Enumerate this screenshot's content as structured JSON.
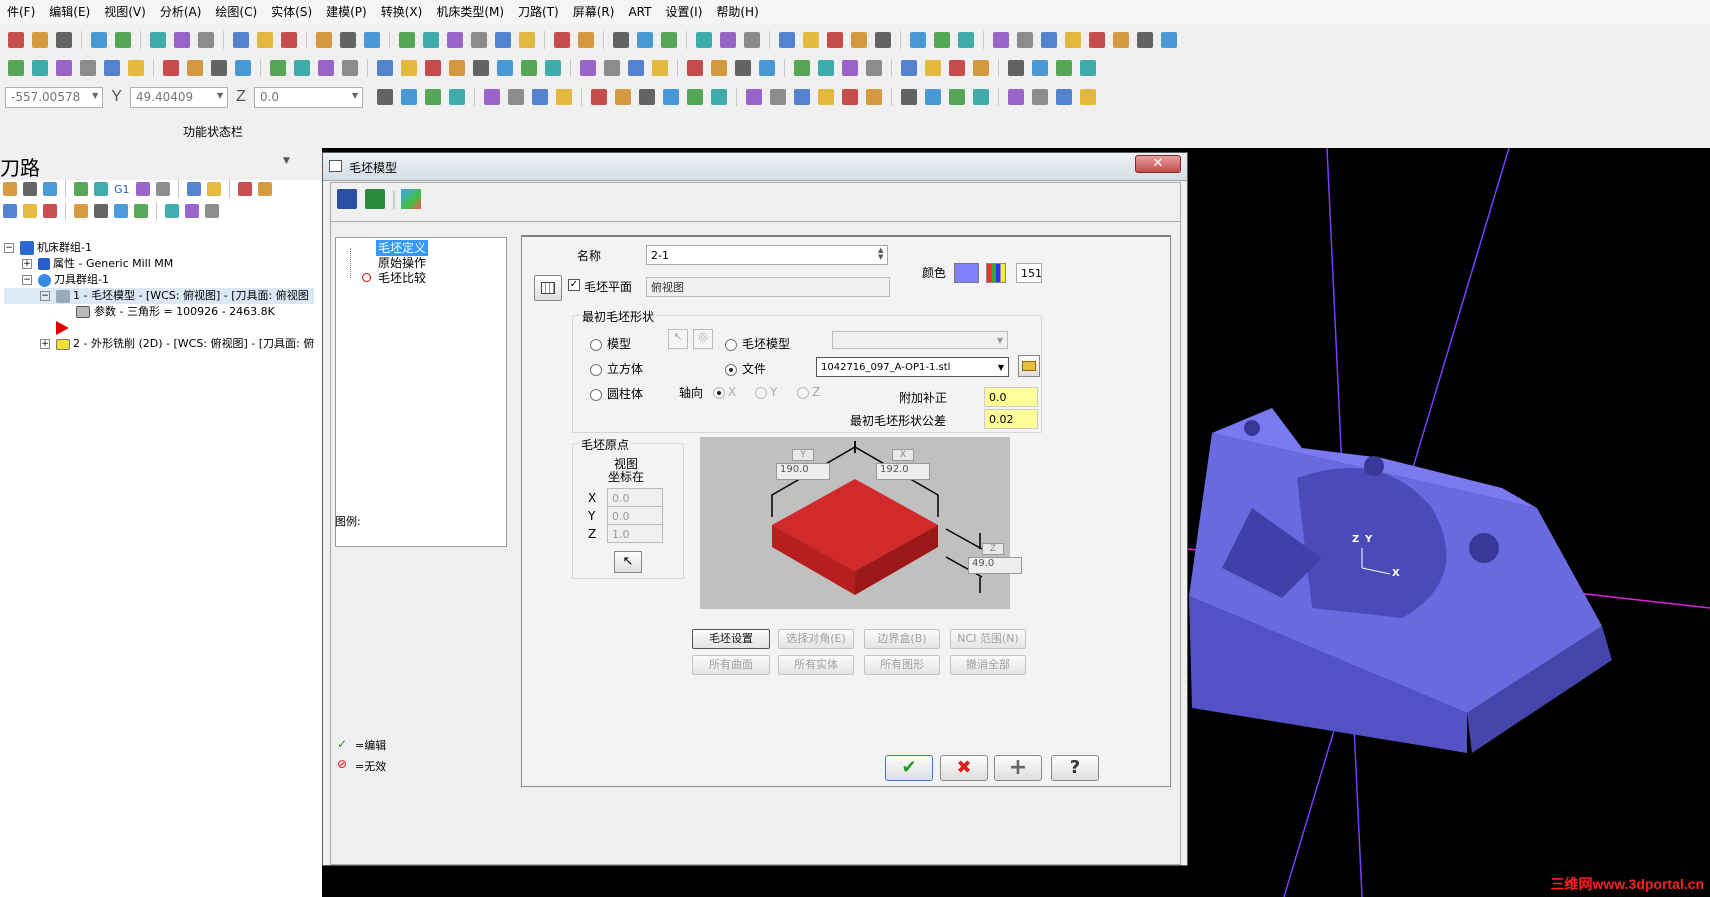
{
  "menu": [
    "件(F)",
    "编辑(E)",
    "视图(V)",
    "分析(A)",
    "绘图(C)",
    "实体(S)",
    "建模(P)",
    "转换(X)",
    "机床类型(M)",
    "刀路(T)",
    "屏幕(R)",
    "ART",
    "设置(I)",
    "帮助(H)"
  ],
  "coords": {
    "x_value": "-557.00578",
    "y_label": "Y",
    "y_value": "49.40409",
    "z_label": "Z",
    "z_value": "0.0"
  },
  "status_bar_label": "功能状态栏",
  "panel": {
    "title": "刀路",
    "tree": [
      {
        "label": "机床群组-1"
      },
      {
        "label": "属性 - Generic Mill MM"
      },
      {
        "label": "刀具群组-1"
      },
      {
        "label": "1 - 毛坯模型 - [WCS: 俯视图] - [刀具面: 俯视图"
      },
      {
        "label": "参数 - 三角形 =  100926 - 2463.8K"
      },
      {
        "label": "2 - 外形铣削 (2D) - [WCS: 俯视图] - [刀具面: 俯"
      }
    ],
    "g1_label": "G1"
  },
  "dialog": {
    "title": "毛坯模型",
    "close": "✕",
    "nav": [
      "毛坯定义",
      "原始操作",
      "毛坯比较"
    ],
    "legend_label": "图例:",
    "legend": [
      {
        "mark": "✓",
        "text": "=编辑"
      },
      {
        "mark": "⊘",
        "text": "=无效"
      }
    ],
    "name_label": "名称",
    "name_value": "2-1",
    "color_label": "颜色",
    "color_hex": "#8080ff",
    "color_num": "151",
    "stock_plane_label": "毛坯平面",
    "stock_plane_value": "俯视图",
    "initial_shape_label": "最初毛坯形状",
    "shape_options": {
      "model": "模型",
      "stock_model": "毛坯模型",
      "cube": "立方体",
      "file": "文件",
      "cylinder": "圆柱体"
    },
    "file_value": "1042716_097_A-OP1-1.stl",
    "axis_label": "轴向",
    "axis_options": [
      "X",
      "Y",
      "Z"
    ],
    "extra_offset_label": "附加补正",
    "extra_offset_value": "0.0",
    "tolerance_label": "最初毛坯形状公差",
    "tolerance_value": "0.02",
    "origin_label": "毛坯原点",
    "origin_view": "视图",
    "origin_coord": "坐标在",
    "origin": [
      {
        "axis": "X",
        "value": "0.0"
      },
      {
        "axis": "Y",
        "value": "0.0"
      },
      {
        "axis": "Z",
        "value": "1.0"
      }
    ],
    "preview": {
      "y_tag": "Y",
      "y_value": "190.0",
      "x_tag": "X",
      "x_value": "192.0",
      "z_tag": "Z",
      "z_value": "49.0",
      "block_color": "#d22a2a"
    },
    "buttons": [
      "毛坯设置",
      "选择对角(E)",
      "边界盒(B)",
      "NCI 范围(N)",
      "所有曲面",
      "所有实体",
      "所有图形",
      "撤消全部"
    ],
    "footer": {
      "ok": "✔",
      "cancel": "✖",
      "add": "+",
      "help": "?"
    }
  },
  "viewport": {
    "bg": "#000000",
    "part_color": "#6a6ae0",
    "axis_z": "Z",
    "axis_y": "Y",
    "axis_x": "X",
    "watermark": "三维网www.3dportal.cn"
  }
}
